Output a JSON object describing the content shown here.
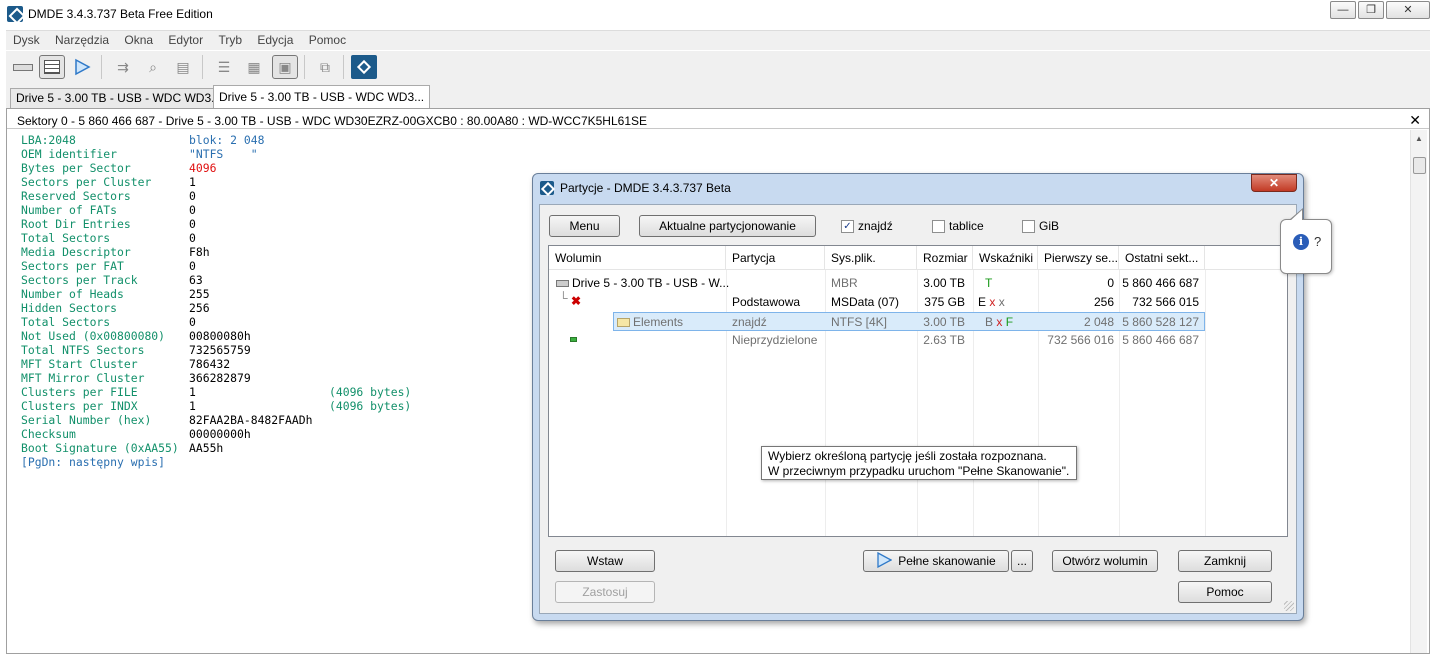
{
  "window": {
    "title": "DMDE 3.4.3.737 Beta Free Edition",
    "minimize": "—",
    "restore": "❐",
    "close": "✕"
  },
  "menu": [
    "Dysk",
    "Narzędzia",
    "Okna",
    "Edytor",
    "Tryb",
    "Edycja",
    "Pomoc"
  ],
  "tabs": [
    {
      "label": "Drive 5 - 3.00 TB - USB - WDC WD3...",
      "active": false
    },
    {
      "label": "Drive 5 - 3.00 TB - USB - WDC WD3...",
      "active": true
    }
  ],
  "content_header": {
    "text": "Sektory 0 - 5 860 466 687 - Drive 5 - 3.00 TB - USB - WDC WD30EZRZ-00GXCB0 : 80.00A80 : WD-WCC7K5HL61SE",
    "close": "✕"
  },
  "boot_sector": {
    "header_left": "LBA:2048",
    "header_right": "blok: 2 048",
    "fields": [
      {
        "key": "OEM identifier",
        "value": "\"NTFS    \"",
        "style": "blue"
      },
      {
        "key": "Bytes per Sector",
        "value": "4096",
        "style": "red"
      },
      {
        "key": "Sectors per Cluster",
        "value": "1"
      },
      {
        "key": "Reserved Sectors",
        "value": "0"
      },
      {
        "key": "Number of FATs",
        "value": "0"
      },
      {
        "key": "Root Dir Entries",
        "value": "0"
      },
      {
        "key": "Total Sectors",
        "value": "0"
      },
      {
        "key": "Media Descriptor",
        "value": "F8h"
      },
      {
        "key": "Sectors per FAT",
        "value": "0"
      },
      {
        "key": "Sectors per Track",
        "value": "63"
      },
      {
        "key": "Number of Heads",
        "value": "255"
      },
      {
        "key": "Hidden Sectors",
        "value": "256"
      },
      {
        "key": "Total Sectors",
        "value": "0"
      },
      {
        "key": "Not Used (0x00800080)",
        "value": "00800080h"
      },
      {
        "key": "Total NTFS Sectors",
        "value": "732565759"
      },
      {
        "key": "MFT Start Cluster",
        "value": "786432"
      },
      {
        "key": "MFT Mirror Cluster",
        "value": "366282879"
      },
      {
        "key": "Clusters per FILE",
        "value": "1",
        "note": "(4096 bytes)"
      },
      {
        "key": "Clusters per INDX",
        "value": "1",
        "note": "(4096 bytes)"
      },
      {
        "key": "Serial Number (hex)",
        "value": "82FAA2BA-8482FAADh"
      },
      {
        "key": "Checksum",
        "value": "00000000h"
      },
      {
        "key": "Boot Signature (0xAA55)",
        "value": "AA55h"
      }
    ],
    "footer": "[PgDn: następny wpis]"
  },
  "dialog": {
    "title": "Partycje - DMDE 3.4.3.737 Beta",
    "close": "✕",
    "menu_button": "Menu",
    "current_partitioning_button": "Aktualne partycjonowanie",
    "checkboxes": [
      {
        "label": "znajdź",
        "checked": true
      },
      {
        "label": "tablice",
        "checked": false
      },
      {
        "label": "GiB",
        "checked": false
      }
    ],
    "columns": [
      "Wolumin",
      "Partycja",
      "Sys.plik.",
      "Rozmiar",
      "Wskaźniki",
      "Pierwszy se...",
      "Ostatni sekt..."
    ],
    "rows": [
      {
        "volume": "Drive 5 - 3.00 TB - USB - W...",
        "partition": "",
        "fs": "MBR",
        "size": "3.00 TB",
        "flags": "T",
        "first": "0",
        "last": "5 860 466 687"
      },
      {
        "volume": "",
        "partition": "Podstawowa",
        "fs": "MSData (07)",
        "size": "375 GB",
        "flags": "E x x",
        "first": "256",
        "last": "732 566 015"
      },
      {
        "volume": "Elements",
        "partition": "znajdź",
        "fs": "NTFS [4K]",
        "size": "3.00 TB",
        "flags": "B x F",
        "first": "2 048",
        "last": "5 860 528 127"
      },
      {
        "volume": "",
        "partition": "Nieprzydzielone",
        "fs": "",
        "size": "2.63 TB",
        "flags": "",
        "first": "732 566 016",
        "last": "5 860 466 687"
      }
    ],
    "tooltip": [
      "Wybierz określoną partycję jeśli została rozpoznana.",
      "W przeciwnym przypadku uruchom \"Pełne Skanowanie\"."
    ],
    "buttons": {
      "insert": "Wstaw",
      "apply": "Zastosuj",
      "full_scan": "Pełne skanowanie",
      "more": "...",
      "open_volume": "Otwórz wolumin",
      "close": "Zamknij",
      "help": "Pomoc"
    }
  },
  "help_balloon": {
    "symbol": "i",
    "text": "?"
  },
  "icons": {
    "app": "dmde-logo-icon",
    "full_scan": "play-icon"
  }
}
